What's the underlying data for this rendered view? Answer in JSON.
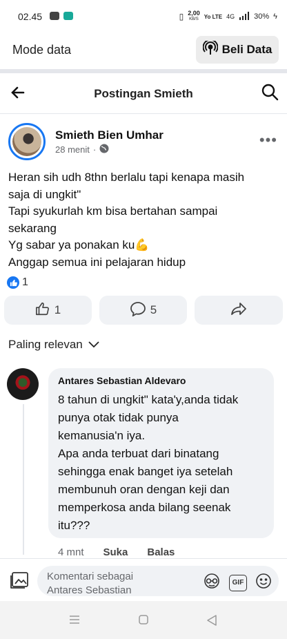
{
  "status_bar": {
    "time": "02.45",
    "speed": "2,00",
    "speed_unit": "KB/S",
    "network": "Yo LTE",
    "signal": "4G",
    "battery": "30%"
  },
  "mode_bar": {
    "label": "Mode data",
    "buy_button": "Beli Data"
  },
  "header": {
    "title": "Postingan Smieth"
  },
  "post": {
    "author": "Smieth Bien Umhar",
    "time": "28 menit",
    "lines": [
      "Heran sih udh 8thn berlalu tapi kenapa masih",
      "saja di ungkit\"",
      "Tapi syukurlah km bisa bertahan sampai",
      "sekarang",
      "Yg sabar ya ponakan ku💪",
      "Anggap semua ini pelajaran hidup"
    ],
    "reaction_count": "1",
    "like_count": "1",
    "comment_count": "5"
  },
  "sort": {
    "label": "Paling relevan"
  },
  "comment": {
    "author": "Antares Sebastian Aldevaro",
    "lines": [
      "8 tahun di ungkit\" kata'y,anda tidak",
      "punya otak tidak punya",
      "kemanusia'n iya.",
      "Apa anda terbuat dari binatang",
      "sehingga enak banget iya setelah",
      "membunuh oran dengan keji dan",
      "memperkosa anda bilang seenak",
      "itu???"
    ],
    "time": "4 mnt",
    "like_label": "Suka",
    "reply_label": "Balas"
  },
  "composer": {
    "placeholder_line1": "Komentari sebagai",
    "placeholder_line2": "Antares Sebastian",
    "gif_label": "GIF"
  },
  "colors": {
    "accent": "#1877f2",
    "pill_bg": "#f0f2f5",
    "muted_text": "#65676b"
  }
}
